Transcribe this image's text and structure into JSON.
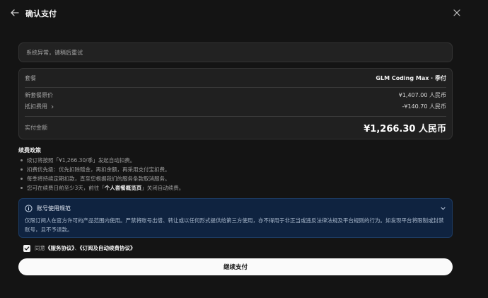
{
  "header": {
    "title": "确认支付",
    "back_icon": "arrow-left-icon",
    "close_icon": "close-icon"
  },
  "error_message": "系统异常，请稍后重试",
  "summary": {
    "plan_label": "套餐",
    "plan_name": "GLM Coding Max · 季付",
    "original_price_label": "新套餐原价",
    "original_price": "¥1,407.00 人民币",
    "deduction_label": "抵扣费用",
    "deduction": "-¥140.70 人民币",
    "total_label": "实付金额",
    "total": "¥1,266.30 人民币"
  },
  "policy": {
    "title": "续费政策",
    "items": [
      {
        "text": "续订将按照「¥1,266.30/季」发起自动扣费。"
      },
      {
        "text": "扣费优先级：优先扣除赠金，再扣余额，再采用支付宝扣费。"
      },
      {
        "text": "每季将持续定期扣款，直至您根据我们的服务条款取消服务。"
      },
      {
        "pre": "您可在续费日前至少3天，前往「",
        "bold": "个人套餐概览页",
        "post": "」关闭自动续费。"
      }
    ]
  },
  "notice": {
    "title": "账号使用规范",
    "body": "仅限订阅人在官方许可的产品范围内使用。严禁将账号出借、转让或以任何形式提供给第三方使用，亦不得用于非正当或违反法律法规及平台规则的行为。如发现平台将限制或封禁账号，且不予退款。"
  },
  "agreement": {
    "checked": true,
    "prefix": "同意",
    "service": "《服务协议》",
    "separator": "、",
    "subscription": "《订阅及自动续费协议》"
  },
  "continue_label": "继续支付",
  "colors": {
    "background": "#141414",
    "card": "#202020",
    "notice_bg": "#0f2340",
    "button": "#fafafa"
  }
}
